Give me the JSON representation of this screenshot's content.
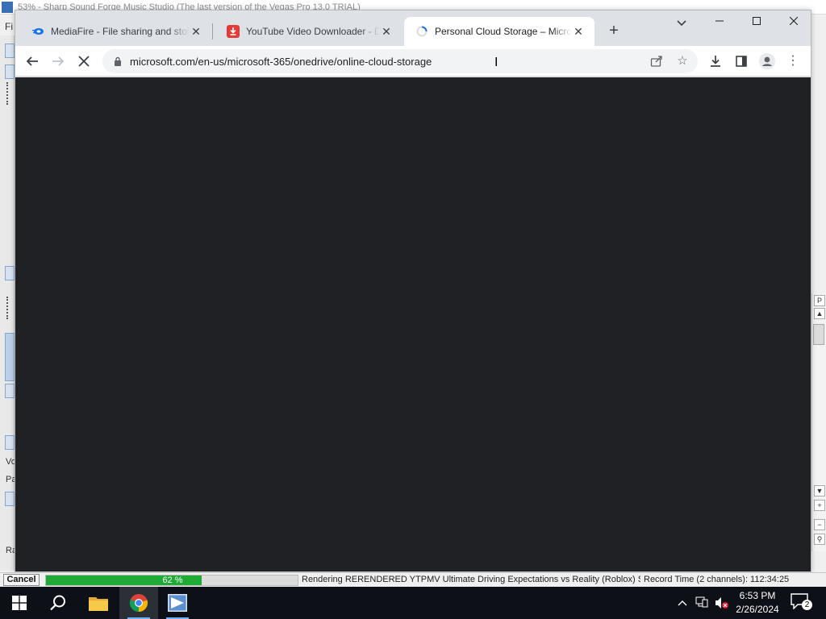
{
  "background_app": {
    "title": "53% - Sharp Sound Forge Music Studio (The last version of the Vegas Pro 13.0 TRIAL)",
    "menu_first_letter": "Fi",
    "labels": {
      "vo": "Vo",
      "pa": "Pa",
      "ra": "Ra"
    }
  },
  "browser": {
    "tabs": [
      {
        "title": "MediaFire - File sharing and storage",
        "icon": "mediafire-icon",
        "active": false
      },
      {
        "title": "YouTube Video Downloader - Download",
        "icon": "download-red-icon",
        "active": false
      },
      {
        "title": "Personal Cloud Storage – Microsoft",
        "icon": "loading-spinner-icon",
        "active": true
      }
    ],
    "close_glyph": "✕",
    "new_tab_glyph": "+",
    "url": "microsoft.com/en-us/microsoft-365/onedrive/online-cloud-storage",
    "page_background": "#202124",
    "loading": true
  },
  "render": {
    "cancel_label": "Cancel",
    "progress_percent": 62,
    "progress_label": "62 %",
    "status_text": "Rendering RERENDERED YTPMV Ultimate Driving Expectations vs Reality (Roblox) Scan",
    "record_time": "Record Time (2 channels): 112:34:25",
    "accent_color": "#1eaa35"
  },
  "taskbar": {
    "time": "6:53 PM",
    "date": "2/26/2024",
    "notification_count": "2",
    "apps": [
      "start-icon",
      "search-icon",
      "file-explorer-icon",
      "chrome-icon",
      "sound-forge-icon"
    ]
  }
}
